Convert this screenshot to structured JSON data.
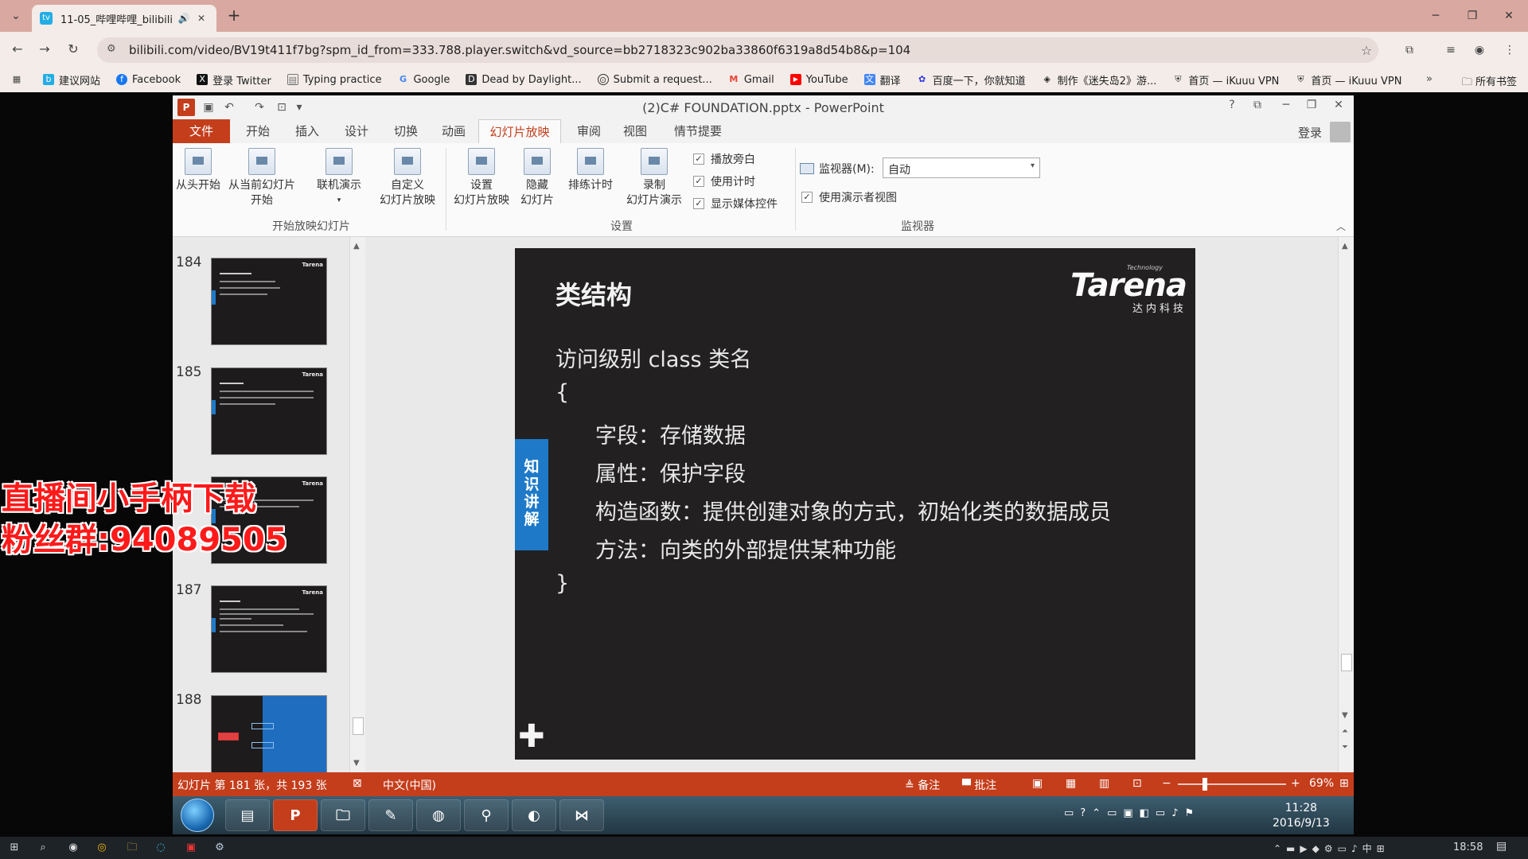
{
  "browser": {
    "tab_title": "11-05_哔哩哔哩_bilibili",
    "url": "bilibili.com/video/BV19t411f7bg?spm_id_from=333.788.player.switch&vd_source=bb2718323c902ba33860f6319a8d54b8&p=104",
    "bookmarks": [
      {
        "label": "建议网站",
        "icon": "bilibili-icon",
        "color": "#23ade5"
      },
      {
        "label": "Facebook",
        "icon": "facebook-icon",
        "color": "#1877f2"
      },
      {
        "label": "登录 Twitter",
        "icon": "x-icon",
        "color": "#111111"
      },
      {
        "label": "Typing practice",
        "icon": "keyboard-icon",
        "color": "#777777"
      },
      {
        "label": "Google",
        "icon": "google-icon",
        "color": "#4285f4"
      },
      {
        "label": "Dead by Daylight...",
        "icon": "dbd-icon",
        "color": "#333333"
      },
      {
        "label": "Submit a request...",
        "icon": "steam-icon",
        "color": "#333333"
      },
      {
        "label": "Gmail",
        "icon": "gmail-icon",
        "color": "#ea4335"
      },
      {
        "label": "YouTube",
        "icon": "youtube-icon",
        "color": "#ff0000"
      },
      {
        "label": "翻译",
        "icon": "translate-icon",
        "color": "#4285f4"
      },
      {
        "label": "百度一下，你就知道",
        "icon": "baidu-icon",
        "color": "#2932e1"
      },
      {
        "label": "制作《迷失岛2》游...",
        "icon": "unity-icon",
        "color": "#222222"
      },
      {
        "label": "首页 — iKuuu VPN",
        "icon": "vpn-icon",
        "color": "#333333"
      },
      {
        "label": "首页 — iKuuu VPN",
        "icon": "vpn-icon",
        "color": "#333333"
      }
    ],
    "more": "»",
    "all_bookmarks": "所有书签"
  },
  "ppt": {
    "title": "(2)C# FOUNDATION.pptx - PowerPoint",
    "tabs": [
      "文件",
      "开始",
      "插入",
      "设计",
      "切换",
      "动画",
      "幻灯片放映",
      "审阅",
      "视图",
      "情节提要"
    ],
    "login": "登录",
    "ribbon": {
      "from_start": "从头开始",
      "from_current_1": "从当前幻灯片",
      "from_current_2": "开始",
      "online": "联机演示",
      "custom_1": "自定义",
      "custom_2": "幻灯片放映",
      "group_start": "开始放映幻灯片",
      "setup_1": "设置",
      "setup_2": "幻灯片放映",
      "hide_1": "隐藏",
      "hide_2": "幻灯片",
      "rehearse": "排练计时",
      "record_1": "录制",
      "record_2": "幻灯片演示",
      "chk_narration": "播放旁白",
      "chk_timing": "使用计时",
      "chk_media": "显示媒体控件",
      "group_setup": "设置",
      "monitor_label": "监视器(M):",
      "monitor_value": "自动",
      "chk_presenter": "使用演示者视图",
      "group_monitor": "监视器"
    },
    "thumb_numbers": [
      "184",
      "185",
      "187",
      "188"
    ],
    "slide": {
      "title": "类结构",
      "brand_small": "Technology",
      "brand_big": "Tarena",
      "brand_cn": "达内科技",
      "side_tag": [
        "知",
        "识",
        "讲",
        "解"
      ],
      "line1": "访问级别 class 类名",
      "line2": "{",
      "line3": "字段：存储数据",
      "line4": "属性：保护字段",
      "line5": "构造函数：提供创建对象的方式，初始化类的数据成员",
      "line6": "方法：向类的外部提供某种功能",
      "line7": "}"
    },
    "status": {
      "slide_count": "幻灯片 第 181 张，共 193 张",
      "language": "中文(中国)",
      "notes": "备注",
      "comments": "批注",
      "zoom": "69%"
    }
  },
  "win7": {
    "time": "11:28",
    "date": "2016/9/13"
  },
  "overlay": {
    "line1": "直播间小手柄下载",
    "line2": "粉丝群:94089505"
  },
  "host": {
    "time": "18:58"
  }
}
